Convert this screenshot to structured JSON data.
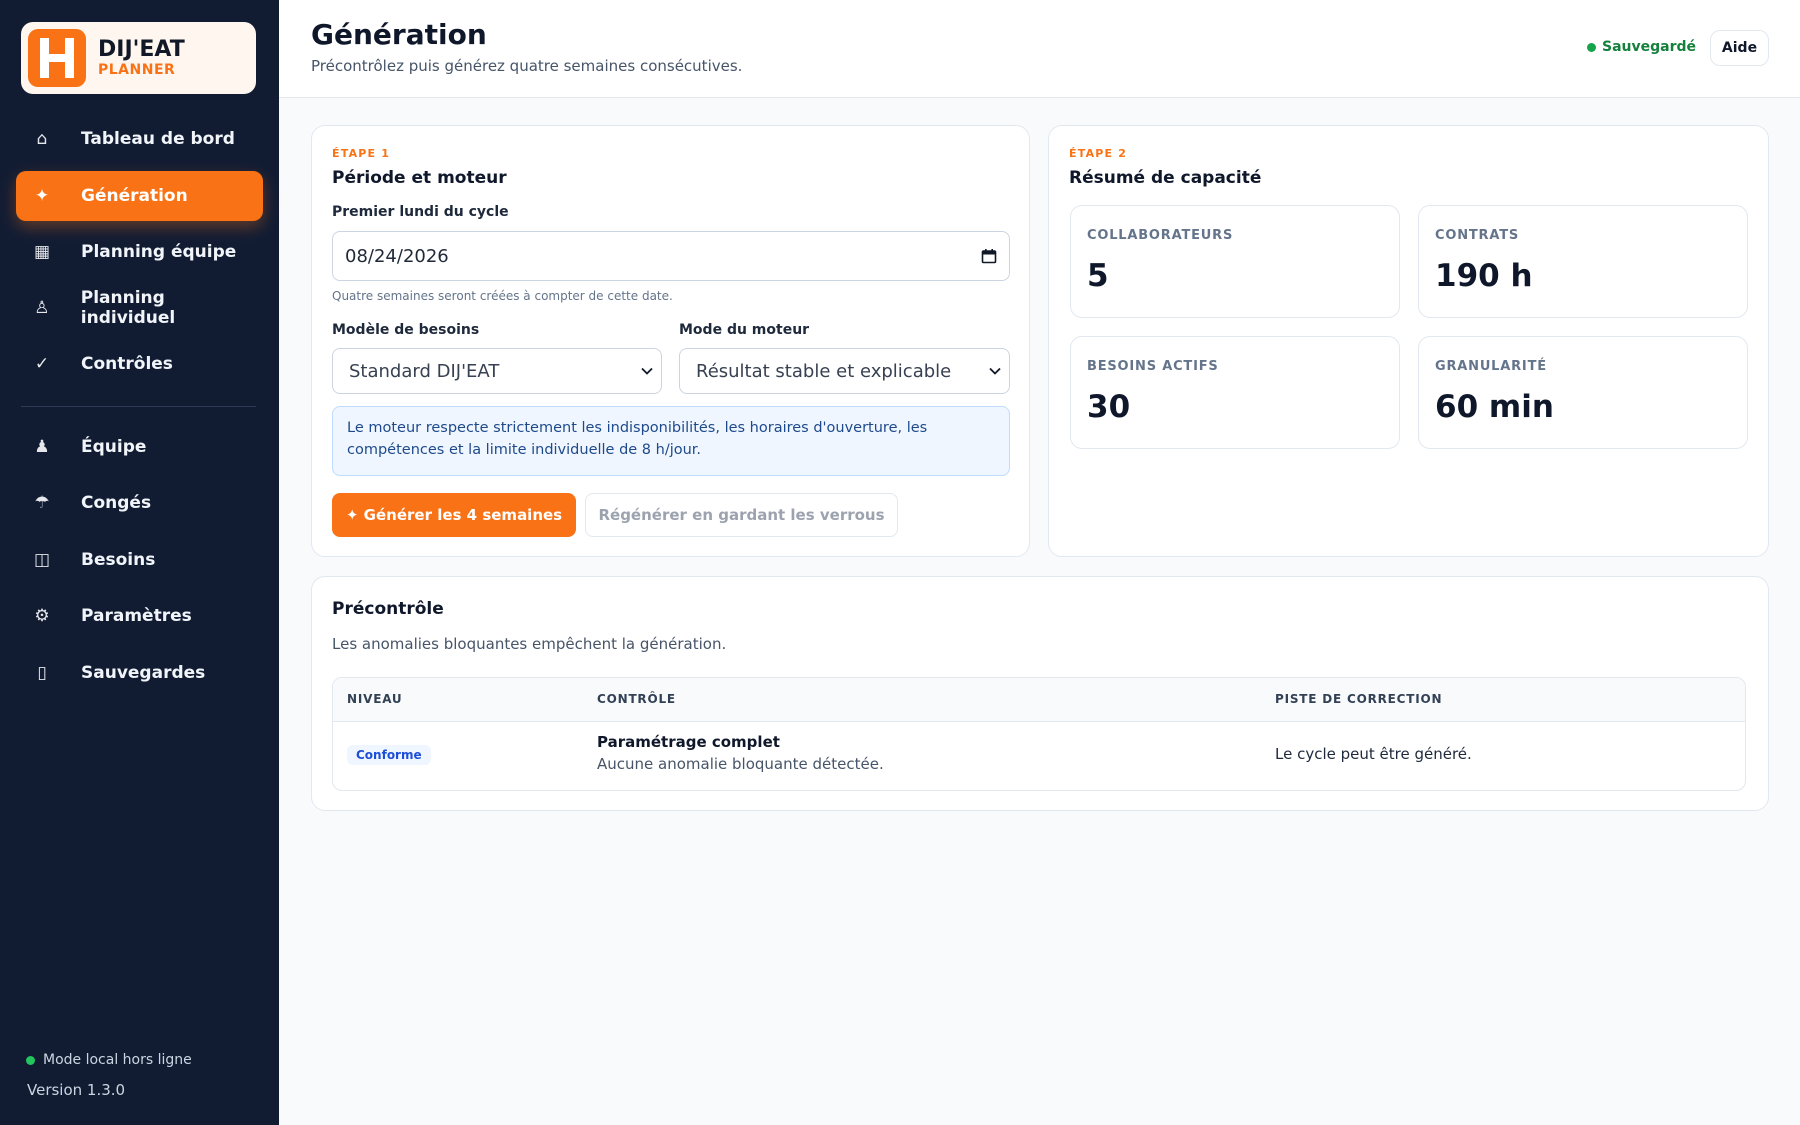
{
  "brand": {
    "mark": "H",
    "name": "DIJ'EAT",
    "sub": "PLANNER",
    "accent": "#f97316"
  },
  "sidebar": {
    "items": [
      {
        "icon": "⌂",
        "label": "Tableau de bord"
      },
      {
        "icon": "✦",
        "label": "Génération"
      },
      {
        "icon": "▦",
        "label": "Planning équipe"
      },
      {
        "icon": "♙",
        "label": "Planning individuel"
      },
      {
        "icon": "✓",
        "label": "Contrôles"
      },
      {
        "icon": "♟",
        "label": "Équipe"
      },
      {
        "icon": "☂",
        "label": "Congés"
      },
      {
        "icon": "◫",
        "label": "Besoins"
      },
      {
        "icon": "⚙",
        "label": "Paramètres"
      },
      {
        "icon": "▯",
        "label": "Sauvegardes"
      }
    ],
    "active": "Génération",
    "status": "Mode local hors ligne",
    "version": "Version 1.3.0"
  },
  "header": {
    "title": "Génération",
    "subtitle": "Précontrôlez puis générez quatre semaines consécutives.",
    "saved": "Sauvegardé",
    "help": "Aide"
  },
  "step1": {
    "eyebrow": "ÉTAPE 1",
    "title": "Période et moteur",
    "date_label": "Premier lundi du cycle",
    "date_value": "08/24/2026",
    "date_hint": "Quatre semaines seront créées à compter de cette date.",
    "model_label": "Modèle de besoins",
    "model_value": "Standard DIJ'EAT",
    "engine_label": "Mode du moteur",
    "engine_value": "Résultat stable et explicable",
    "info": "Le moteur respecte strictement les indisponibilités, les horaires d'ouverture, les compétences et la limite individuelle de 8 h/jour.",
    "generate": "✦ Générer les 4 semaines",
    "regenerate": "Régénérer en gardant les verrous"
  },
  "step2": {
    "eyebrow": "ÉTAPE 2",
    "title": "Résumé de capacité",
    "stats": [
      {
        "label": "COLLABORATEURS",
        "value": "5"
      },
      {
        "label": "CONTRATS",
        "value": "190 h"
      },
      {
        "label": "BESOINS ACTIFS",
        "value": "30"
      },
      {
        "label": "GRANULARITÉ",
        "value": "60 min"
      }
    ]
  },
  "precheck": {
    "title": "Précontrôle",
    "description": "Les anomalies bloquantes empêchent la génération.",
    "columns": [
      "NIVEAU",
      "CONTRÔLE",
      "PISTE DE CORRECTION"
    ],
    "rows": [
      {
        "level": "Conforme",
        "title": "Paramétrage complet",
        "detail": "Aucune anomalie bloquante détectée.",
        "fix": "Le cycle peut être généré."
      }
    ]
  }
}
